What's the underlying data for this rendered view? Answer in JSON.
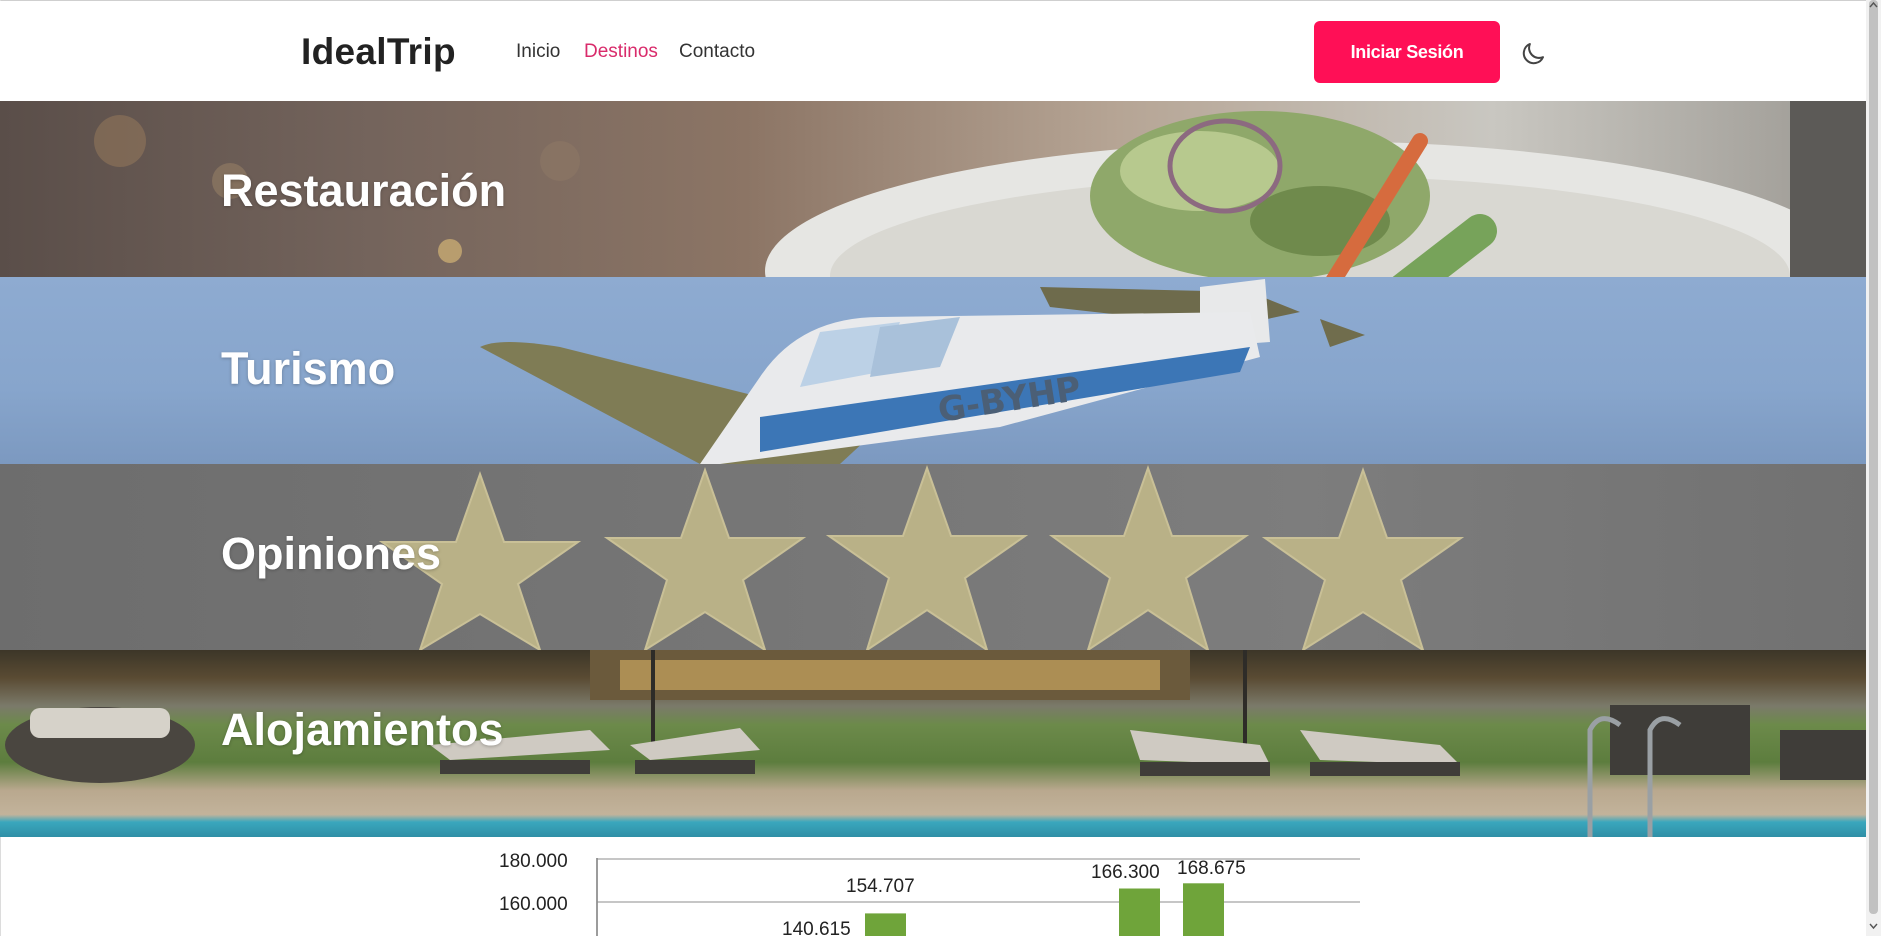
{
  "header": {
    "brand": "IdealTrip",
    "nav": [
      {
        "label": "Inicio",
        "active": false
      },
      {
        "label": "Destinos",
        "active": true
      },
      {
        "label": "Contacto",
        "active": false
      }
    ],
    "login_label": "Iniciar Sesión",
    "theme_icon": "moon-icon",
    "accent_color": "#ff0f56",
    "active_link_color": "#d92b6b"
  },
  "sections": [
    {
      "title": "Restauración",
      "image": "salad-plate-photo"
    },
    {
      "title": "Turismo",
      "image": "small-airplane-photo"
    },
    {
      "title": "Opiniones",
      "image": "five-stars-photo"
    },
    {
      "title": "Alojamientos",
      "image": "pool-loungers-photo"
    }
  ],
  "chart_data": {
    "type": "bar",
    "series_color": "#6fa43a",
    "y_ticks_visible": [
      "180.000",
      "160.000"
    ],
    "ylim": [
      0,
      180000
    ],
    "bars_visible": [
      {
        "label": "140.615",
        "value": 140615
      },
      {
        "label": "154.707",
        "value": 154707
      },
      {
        "label": "166.300",
        "value": 166300
      },
      {
        "label": "168.675",
        "value": 168675
      }
    ],
    "grid": true
  }
}
